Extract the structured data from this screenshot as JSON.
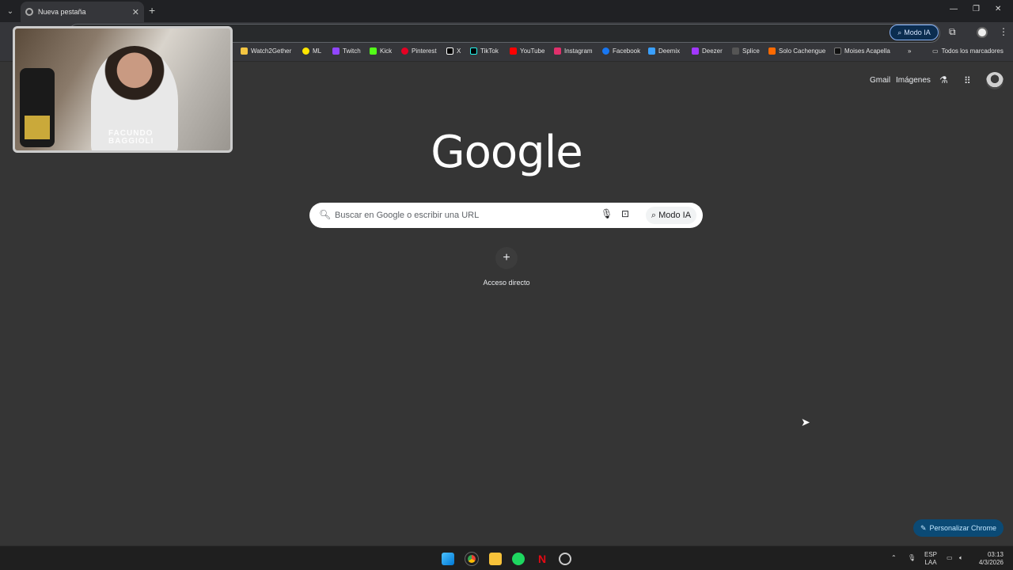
{
  "browser": {
    "tab_title": "Nueva pestaña",
    "modo_ia_label": "Modo IA",
    "bookmarks": [
      {
        "label": "Watch2Gether",
        "color": "#f4c542"
      },
      {
        "label": "ML",
        "color": "#ffe600"
      },
      {
        "label": "Twitch",
        "color": "#9146ff"
      },
      {
        "label": "Kick",
        "color": "#53fc18"
      },
      {
        "label": "Pinterest",
        "color": "#e60023"
      },
      {
        "label": "X",
        "color": "#ffffff"
      },
      {
        "label": "TikTok",
        "color": "#000000"
      },
      {
        "label": "YouTube",
        "color": "#ff0000"
      },
      {
        "label": "Instagram",
        "color": "#e1306c"
      },
      {
        "label": "Facebook",
        "color": "#1877f2"
      },
      {
        "label": "Deemix",
        "color": "#3aa0ff"
      },
      {
        "label": "Deezer",
        "color": "#a238ff"
      },
      {
        "label": "Splice",
        "color": "#222222"
      },
      {
        "label": "Solo Cachengue",
        "color": "#ff6a00"
      },
      {
        "label": "Moises Acapella",
        "color": "#111111"
      }
    ],
    "all_bookmarks_label": "Todos los marcadores"
  },
  "webcam": {
    "name_line1": "FACUNDO",
    "name_line2": "BAGGIOLI"
  },
  "google": {
    "top_links": {
      "gmail": "Gmail",
      "images": "Imágenes"
    },
    "logo": "Google",
    "search_placeholder": "Buscar en Google o escribir una URL",
    "modo_ia": "Modo IA",
    "shortcut_label": "Acceso directo",
    "customize_label": "Personalizar Chrome"
  },
  "taskbar": {
    "lang_top": "ESP",
    "lang_bottom": "LAA",
    "time": "03:13",
    "date": "4/3/2026"
  },
  "colors": {
    "page_bg": "#353535",
    "accent": "#8ab4f8",
    "customize_bg": "#0b4a75"
  }
}
